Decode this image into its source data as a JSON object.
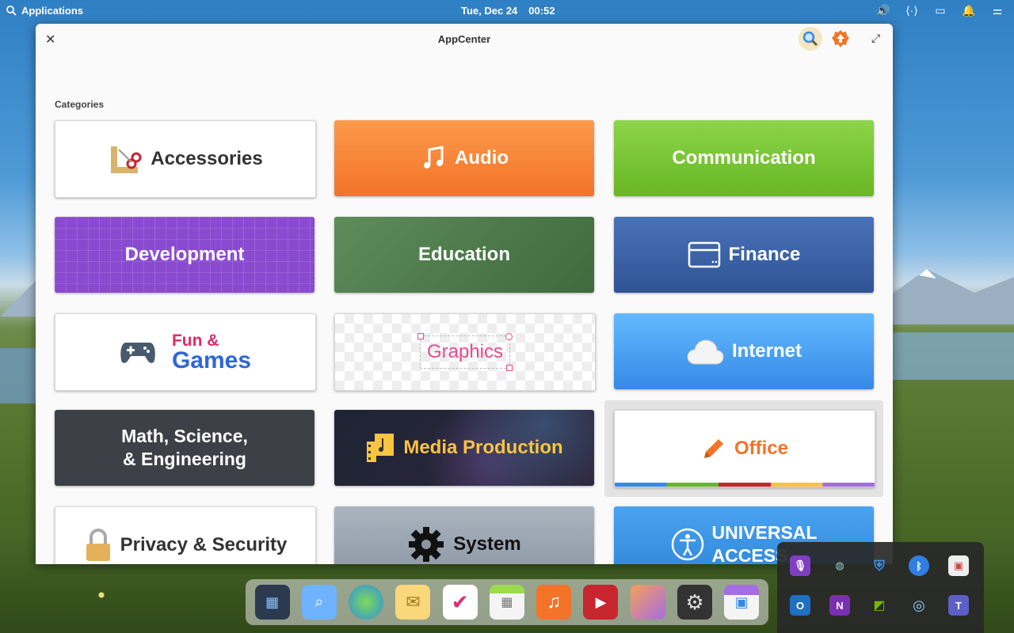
{
  "panel": {
    "applications_label": "Applications",
    "date": "Tue, Dec 24",
    "time": "00:52"
  },
  "window": {
    "title": "AppCenter",
    "categories_heading": "Categories"
  },
  "categories": [
    {
      "label": "Accessories"
    },
    {
      "label": "Audio"
    },
    {
      "label": "Communication"
    },
    {
      "label": "Development"
    },
    {
      "label": "Education"
    },
    {
      "label": "Finance"
    },
    {
      "label_line1": "Fun &",
      "label_line2": "Games"
    },
    {
      "label": "Graphics"
    },
    {
      "label": "Internet"
    },
    {
      "label_line1": "Math, Science,",
      "label_line2": "& Engineering"
    },
    {
      "label": "Media Production"
    },
    {
      "label": "Office"
    },
    {
      "label": "Privacy & Security"
    },
    {
      "label": "System"
    },
    {
      "label_line1": "UNIVERSAL",
      "label_line2": "ACCESS"
    }
  ],
  "colors": {
    "audio": "#f37329",
    "communication": "#68b723",
    "development": "#7e3fc2",
    "education": "#4f7a4c",
    "finance": "#3a60a6",
    "internet": "#3c9ff0",
    "math": "#3b3e43",
    "office_text": "#f37329",
    "graphics_text": "#e94a8c",
    "games_pink": "#de2b6e",
    "games_blue": "#2f66d6"
  },
  "dock": [
    "multitasking-icon",
    "files-icon",
    "browser-icon",
    "mail-icon",
    "tasks-icon",
    "calendar-icon",
    "music-icon",
    "videos-icon",
    "photos-icon",
    "settings-icon",
    "appcenter-icon"
  ],
  "tray_overflow": [
    "microphone-icon",
    "vpn-globe-icon",
    "shield-warning-icon",
    "bluetooth-icon",
    "teamviewer-icon",
    "outlook-icon",
    "onenote-icon",
    "nvidia-icon",
    "sync-icon",
    "teams-icon"
  ]
}
